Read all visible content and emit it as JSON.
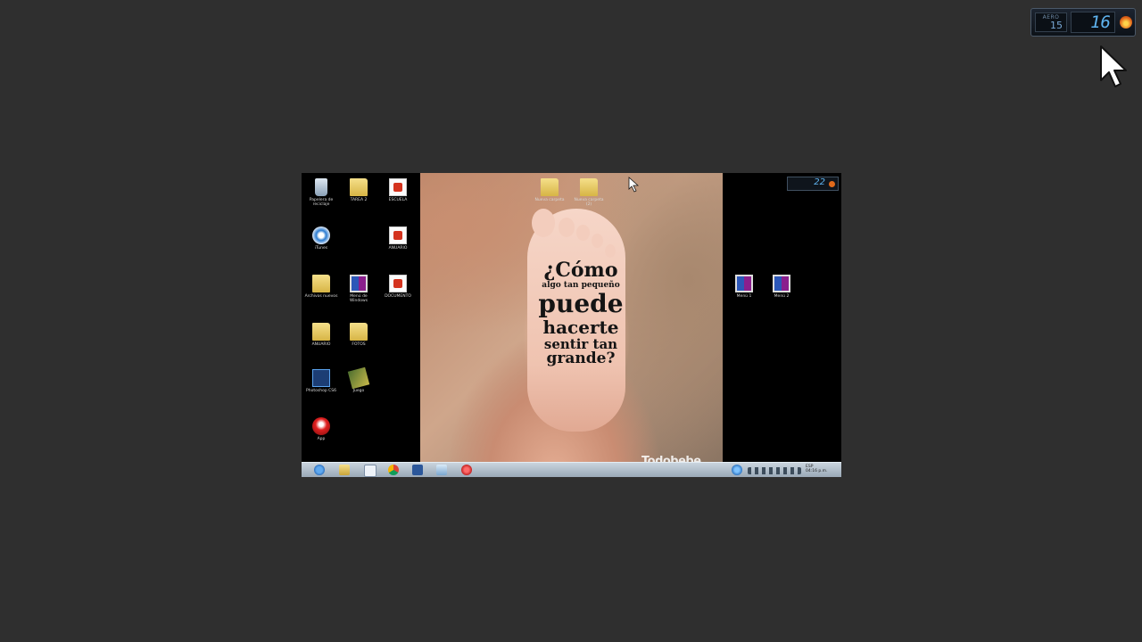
{
  "gadget": {
    "small_top": "AERO",
    "small_value": "15",
    "big_value": "16",
    "flame_icon": "flame-icon"
  },
  "desktop": {
    "quote": {
      "line1": "¿Cómo",
      "line2": "algo tan pequeño",
      "line3": "puede",
      "line4": "hacerte",
      "line5": "sentir tan",
      "line6": "grande?"
    },
    "brand": "Todobebe",
    "mini_gadget_value": "22",
    "left_icons": [
      {
        "icon": "recycle-bin-icon",
        "label": "Papelera de reciclaje"
      },
      {
        "icon": "folder-icon",
        "label": "TAREA 2"
      },
      {
        "icon": "pdf-icon",
        "label": "ESCUELA"
      },
      {
        "icon": "itunes-icon",
        "label": "iTunes"
      },
      {
        "icon": "pdf-icon",
        "label": "ANUARIO"
      },
      {
        "icon": "folder-icon",
        "label": "Archivos nuevos"
      },
      {
        "icon": "windows-icon",
        "label": "Menú de Windows"
      },
      {
        "icon": "pdf-icon",
        "label": "DOCUMENTO"
      },
      {
        "icon": "folder-icon",
        "label": "ANUARIO"
      },
      {
        "icon": "folder-icon",
        "label": "FOTOS"
      },
      {
        "icon": "photoshop-icon",
        "label": "Photoshop CS6"
      },
      {
        "icon": "game-icon",
        "label": "Juego"
      },
      {
        "icon": "red-app-icon",
        "label": "App"
      }
    ],
    "top_icons": [
      {
        "icon": "folder-icon",
        "label": "Nueva carpeta"
      },
      {
        "icon": "folder-icon",
        "label": "Nueva carpeta (2)"
      }
    ],
    "right_icons": [
      {
        "icon": "windows-icon",
        "label": "Menú 1"
      },
      {
        "icon": "windows-icon",
        "label": "Menú 2"
      }
    ],
    "tray": {
      "line1": "ESP",
      "line2": "04:16 p.m."
    }
  },
  "colors": {
    "background": "#2f2f2f",
    "taskbar": "#a9b6c2",
    "gadget_digit": "#5fb4f0"
  }
}
